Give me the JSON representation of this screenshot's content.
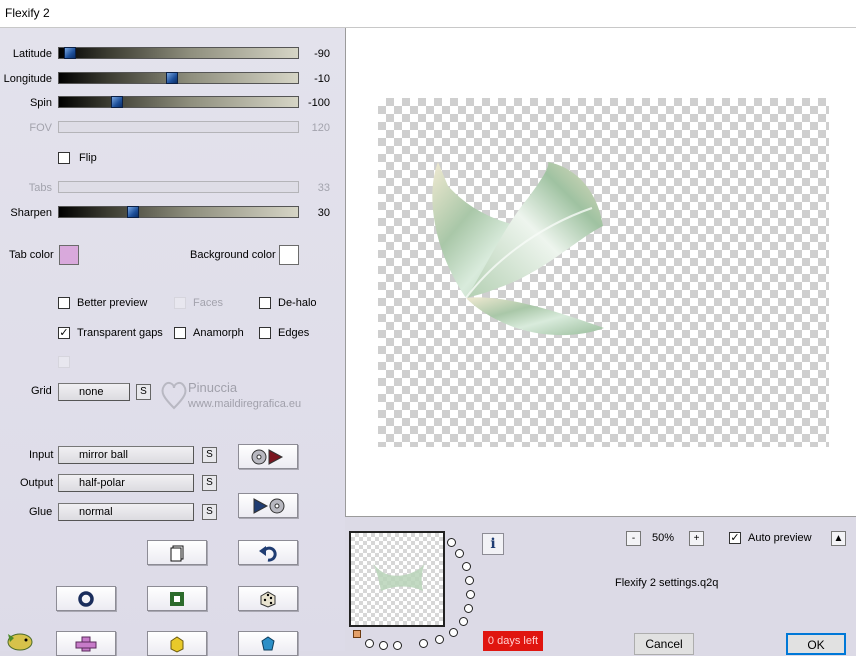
{
  "window": {
    "title": "Flexify 2"
  },
  "sliders": {
    "latitude": {
      "label": "Latitude",
      "value": "-90",
      "fraction": 0.02
    },
    "longitude": {
      "label": "Longitude",
      "value": "-10",
      "fraction": 0.47
    },
    "spin": {
      "label": "Spin",
      "value": "-100",
      "fraction": 0.23
    },
    "fov": {
      "label": "FOV",
      "value": "120"
    },
    "tabs": {
      "label": "Tabs",
      "value": "33"
    },
    "sharpen": {
      "label": "Sharpen",
      "value": "30",
      "fraction": 0.3
    }
  },
  "flip": {
    "label": "Flip",
    "checked": false
  },
  "colors": {
    "tab_label": "Tab color",
    "tab_color": "#d9a9dc",
    "bg_label": "Background color",
    "bg_color": "#ffffff"
  },
  "options": {
    "better_preview": {
      "label": "Better preview",
      "checked": false
    },
    "faces": {
      "label": "Faces",
      "checked": false
    },
    "dehalo": {
      "label": "De-halo",
      "checked": false
    },
    "transparent_gaps": {
      "label": "Transparent gaps",
      "checked": true
    },
    "anamorph": {
      "label": "Anamorph",
      "checked": false
    },
    "edges": {
      "label": "Edges",
      "checked": false
    }
  },
  "grid": {
    "label": "Grid",
    "value": "none",
    "s": "S"
  },
  "mapping": {
    "input": {
      "label": "Input",
      "value": "mirror ball"
    },
    "output": {
      "label": "Output",
      "value": "half-polar"
    },
    "glue": {
      "label": "Glue",
      "value": "normal"
    },
    "s": "S"
  },
  "watermark": {
    "brand": "Pinuccia",
    "url": "www.maildiregrafica.eu"
  },
  "zoom": {
    "minus": "-",
    "value": "50%",
    "plus": "+"
  },
  "auto_preview": {
    "label": "Auto preview",
    "checked": true,
    "arrow": "▲"
  },
  "settings_file": "Flexify 2 settings.q2q",
  "info": "i",
  "trial": "0 days left",
  "buttons": {
    "cancel": "Cancel",
    "ok": "OK"
  },
  "icons": [
    "copy-icon",
    "undo-icon",
    "ring-icon",
    "square-icon",
    "dice-icon",
    "cross-icon",
    "cube-icon",
    "gem-icon",
    "swap-io-icon",
    "swap-oi-icon",
    "info-icon",
    "fish-icon"
  ]
}
